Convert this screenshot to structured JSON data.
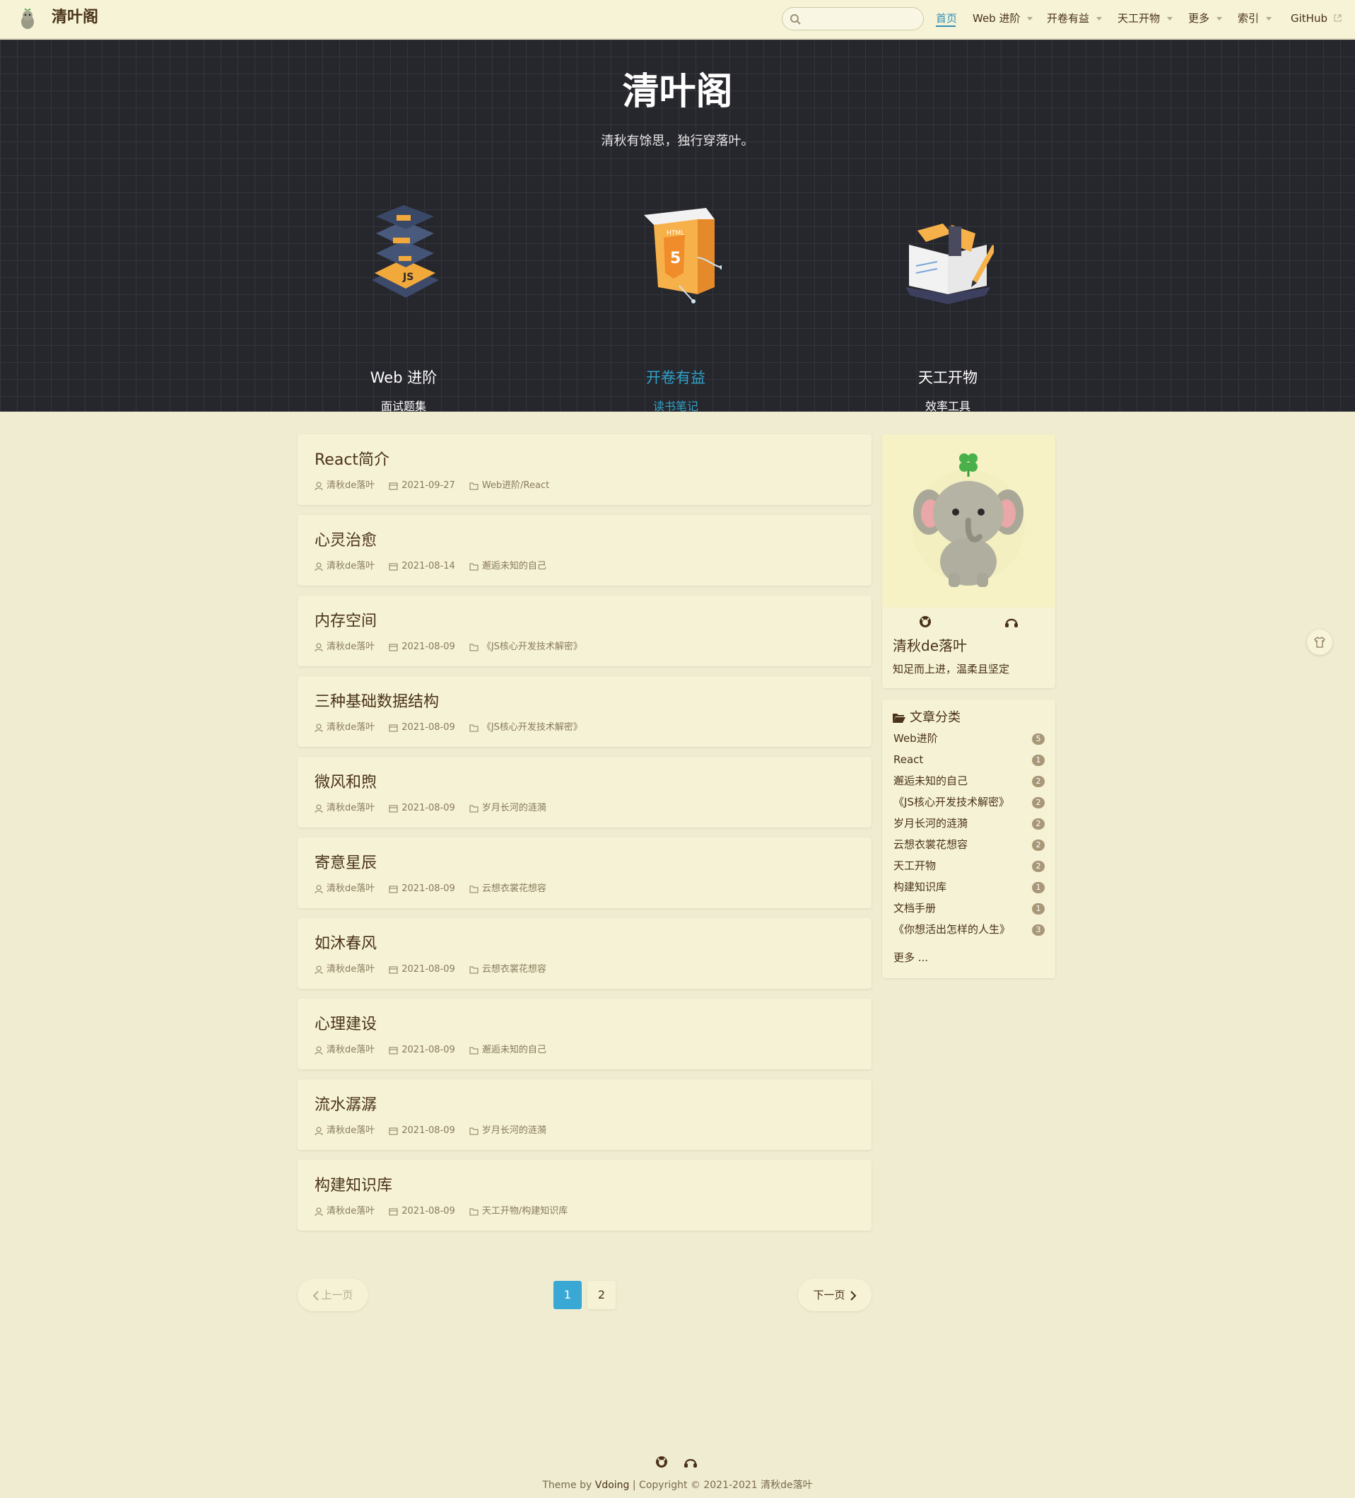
{
  "header": {
    "site_name": "清叶阁",
    "search": {
      "placeholder": "",
      "value": ""
    },
    "nav": [
      {
        "label": "首页",
        "dropdown": false,
        "active": true
      },
      {
        "label": "Web 进阶",
        "dropdown": true
      },
      {
        "label": "开卷有益",
        "dropdown": true
      },
      {
        "label": "天工开物",
        "dropdown": true
      },
      {
        "label": "更多",
        "dropdown": true
      },
      {
        "label": "索引",
        "dropdown": true
      },
      {
        "label": "GitHub",
        "dropdown": false,
        "external": true
      }
    ]
  },
  "hero": {
    "title": "清叶阁",
    "description": "清秋有馀思，独行穿落叶。",
    "features": [
      {
        "title": "Web 进阶",
        "desc": "面试题集",
        "icon": "js-layers-icon"
      },
      {
        "title": "开卷有益",
        "desc": "读书笔记",
        "icon": "html5-book-icon",
        "highlight": true
      },
      {
        "title": "天工开物",
        "desc": "效率工具",
        "icon": "open-book-pencil-icon"
      }
    ]
  },
  "posts": [
    {
      "title": "React简介",
      "author": "清秋de落叶",
      "date": "2021-09-27",
      "category": "Web进阶/React"
    },
    {
      "title": "心灵治愈",
      "author": "清秋de落叶",
      "date": "2021-08-14",
      "category": "邂逅未知的自己"
    },
    {
      "title": "内存空间",
      "author": "清秋de落叶",
      "date": "2021-08-09",
      "category": "《JS核心开发技术解密》"
    },
    {
      "title": "三种基础数据结构",
      "author": "清秋de落叶",
      "date": "2021-08-09",
      "category": "《JS核心开发技术解密》"
    },
    {
      "title": "微风和煦",
      "author": "清秋de落叶",
      "date": "2021-08-09",
      "category": "岁月长河的涟漪"
    },
    {
      "title": "寄意星辰",
      "author": "清秋de落叶",
      "date": "2021-08-09",
      "category": "云想衣裳花想容"
    },
    {
      "title": "如沐春风",
      "author": "清秋de落叶",
      "date": "2021-08-09",
      "category": "云想衣裳花想容"
    },
    {
      "title": "心理建设",
      "author": "清秋de落叶",
      "date": "2021-08-09",
      "category": "邂逅未知的自己"
    },
    {
      "title": "流水潺潺",
      "author": "清秋de落叶",
      "date": "2021-08-09",
      "category": "岁月长河的涟漪"
    },
    {
      "title": "构建知识库",
      "author": "清秋de落叶",
      "date": "2021-08-09",
      "category": "天工开物/构建知识库"
    }
  ],
  "pagination": {
    "prev": "上一页",
    "next": "下一页",
    "pages": [
      "1",
      "2"
    ],
    "current": "1"
  },
  "blogger": {
    "name": "清秋de落叶",
    "slogan": "知足而上进，温柔且坚定"
  },
  "categories": {
    "title": "文章分类",
    "items": [
      {
        "name": "Web进阶",
        "count": "5"
      },
      {
        "name": "React",
        "count": "1"
      },
      {
        "name": "邂逅未知的自己",
        "count": "2"
      },
      {
        "name": "《JS核心开发技术解密》",
        "count": "2"
      },
      {
        "name": "岁月长河的涟漪",
        "count": "2"
      },
      {
        "name": "云想衣裳花想容",
        "count": "2"
      },
      {
        "name": "天工开物",
        "count": "2"
      },
      {
        "name": "构建知识库",
        "count": "1"
      },
      {
        "name": "文档手册",
        "count": "1"
      },
      {
        "name": "《你想活出怎样的人生》",
        "count": "3"
      }
    ],
    "more": "更多 ..."
  },
  "footer": {
    "theme_prefix": "Theme by ",
    "theme_name": "Vdoing",
    "copyright": " | Copyright © 2021-2021 清秋de落叶"
  },
  "colors": {
    "accent": "#2f8fb8",
    "page_bg": "#efecd1",
    "card_bg": "#f5f2d5",
    "hero_bg": "#26262d"
  }
}
